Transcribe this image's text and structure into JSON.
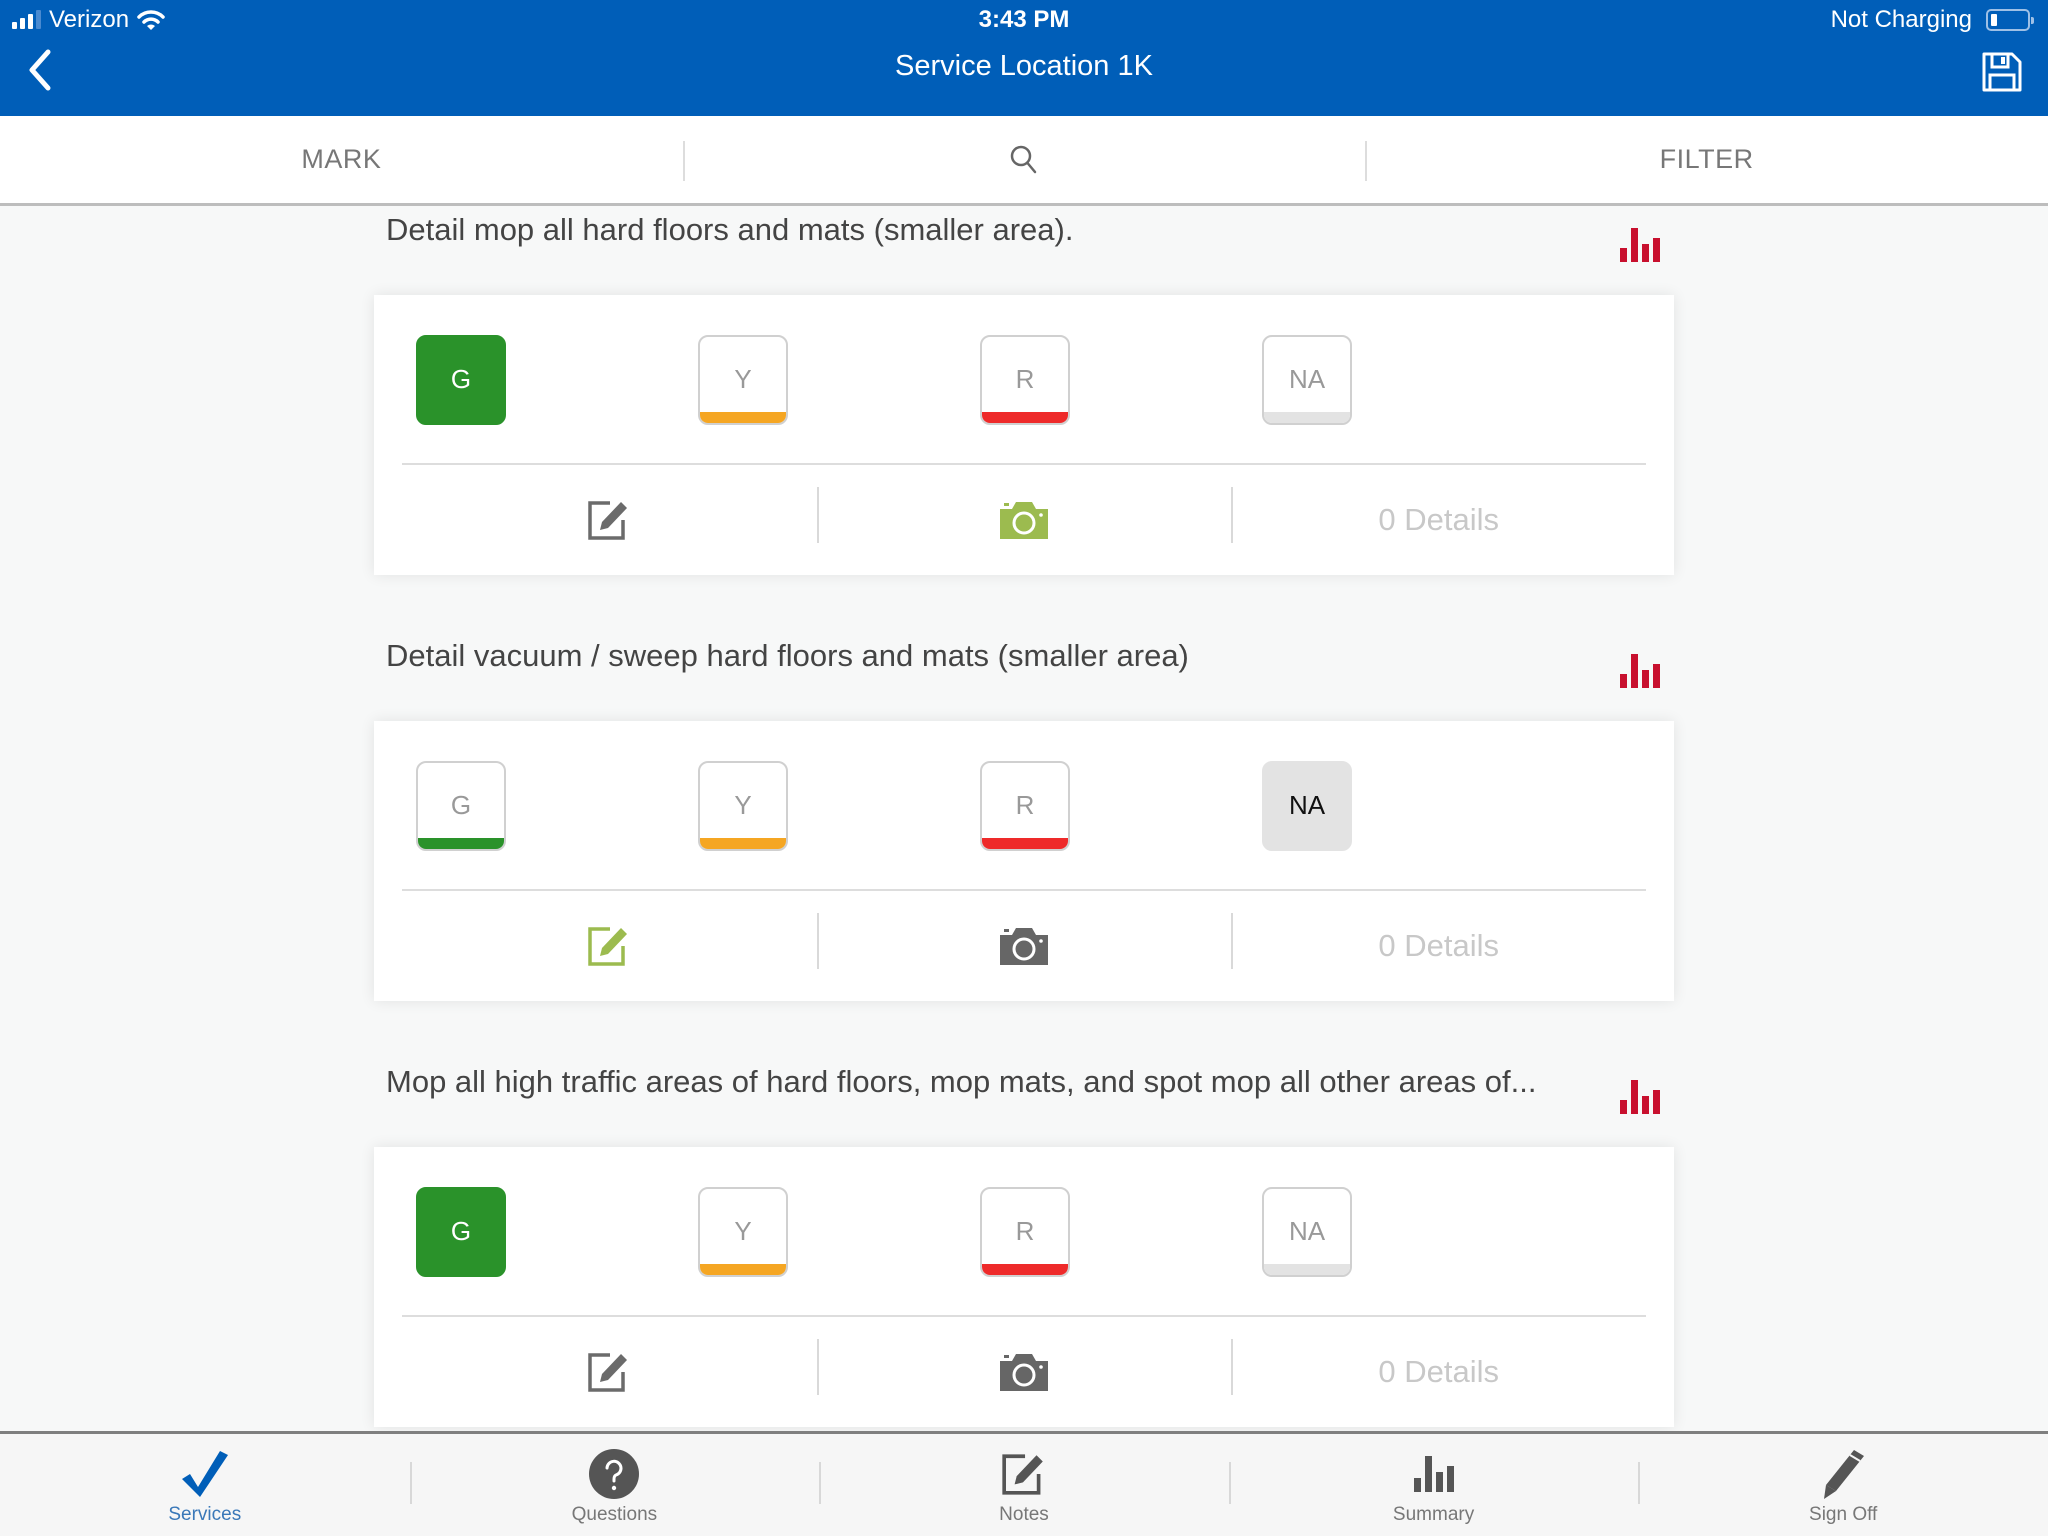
{
  "status_bar": {
    "carrier": "Verizon",
    "time": "3:43 PM",
    "battery_status": "Not Charging"
  },
  "nav": {
    "title": "Service Location 1K",
    "back_icon": "chevron-left-icon",
    "save_icon": "floppy-disk-icon"
  },
  "toolbar": {
    "mark_label": "MARK",
    "search_icon": "search-icon",
    "filter_label": "FILTER"
  },
  "colors": {
    "brand_blue": "#005eb8",
    "green": "#2a922a",
    "yellow": "#f5a623",
    "red": "#ee2a2a",
    "na_gray": "#e3e3e3",
    "accent_green_icon": "#9cbb4f",
    "chart_red": "#c8102e"
  },
  "rating_labels": {
    "g": "G",
    "y": "Y",
    "r": "R",
    "na": "NA"
  },
  "services": [
    {
      "title": "Detail mop all hard floors and mats (smaller area).",
      "selected": "G",
      "note_active": false,
      "photo_active": true,
      "details": "0 Details"
    },
    {
      "title": "Detail vacuum / sweep hard floors and mats (smaller area)",
      "selected": "NA",
      "note_active": true,
      "photo_active": false,
      "details": "0 Details"
    },
    {
      "title": "Mop all high traffic areas of hard floors, mop mats, and spot mop all other areas of...",
      "selected": "G",
      "note_active": false,
      "photo_active": false,
      "details": "0 Details"
    }
  ],
  "tabs": [
    {
      "label": "Services",
      "icon": "checkmark-icon",
      "active": true
    },
    {
      "label": "Questions",
      "icon": "question-circle-icon",
      "active": false
    },
    {
      "label": "Notes",
      "icon": "edit-note-icon",
      "active": false
    },
    {
      "label": "Summary",
      "icon": "bar-chart-icon",
      "active": false
    },
    {
      "label": "Sign Off",
      "icon": "pencil-icon",
      "active": false
    }
  ]
}
